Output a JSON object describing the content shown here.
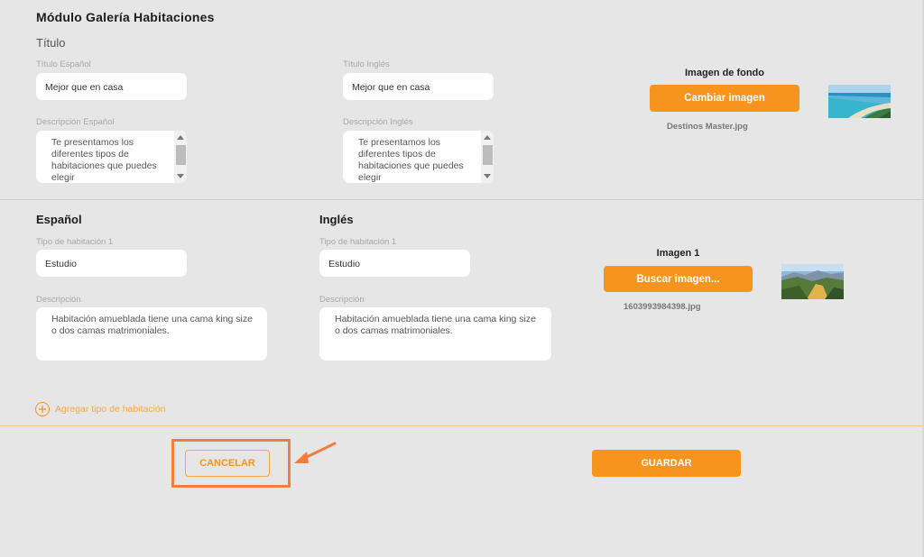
{
  "module": {
    "title": "Módulo Galería Habitaciones",
    "subtitle": "Título"
  },
  "titulo": {
    "es_label": "Título Español",
    "es_value": "Mejor que en casa",
    "en_label": "Título Inglés",
    "en_value": "Mejor que en casa",
    "desc_es_label": "Descripción Español",
    "desc_es_value": "Te presentamos los diferentes tipos de habitaciones que puedes elegir",
    "desc_en_label": "Descripción Inglés",
    "desc_en_value": "Te presentamos los diferentes tipos de habitaciones que puedes elegir"
  },
  "background": {
    "caption": "Imagen de fondo",
    "button": "Cambiar imagen",
    "file_name": "Destinos Master.jpg",
    "thumb_icon": "beach-photo"
  },
  "rooms": {
    "es_heading": "Español",
    "en_heading": "Inglés",
    "type_es_label": "Tipo de habitación 1",
    "type_es_value": "Estudio",
    "type_en_label": "Tipo de habitación 1",
    "type_en_value": "Estudio",
    "desc_es_label": "Descripción",
    "desc_es_value": "Habitación amueblada tiene una cama king size o dos camas matrimoniales.",
    "desc_en_label": "Descripción",
    "desc_en_value": "Habitación amueblada tiene una cama king size o dos camas matrimoniales.",
    "image_caption": "Imagen 1",
    "image_button": "Buscar imagen...",
    "image_file": "1603993984398.jpg",
    "thumb_icon": "mountain-photo",
    "add_link": "Agregar tipo de habitación"
  },
  "footer": {
    "cancel": "CANCELAR",
    "save": "GUARDAR"
  },
  "colors": {
    "accent": "#f7941d",
    "highlight": "#f47c3c",
    "background": "#e6e6e6"
  }
}
